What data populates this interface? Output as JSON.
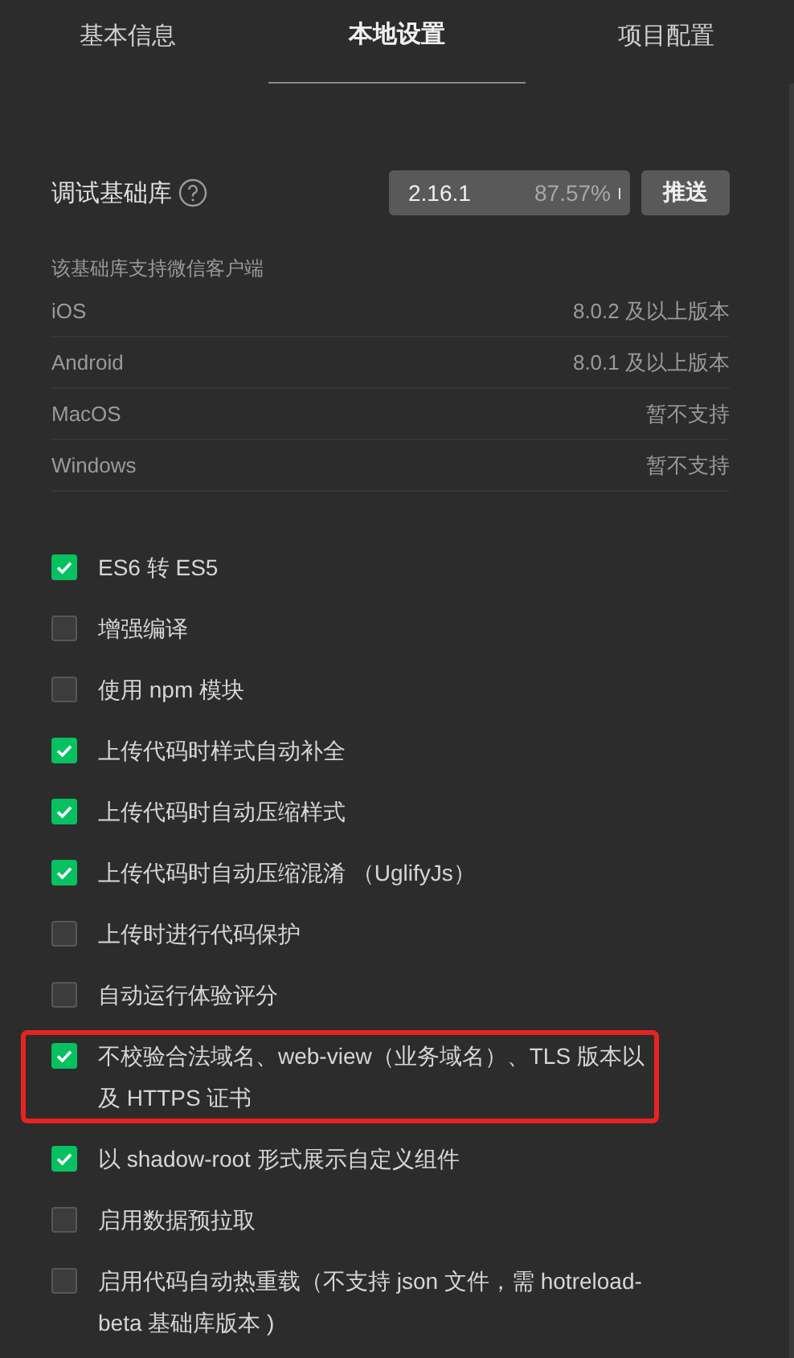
{
  "tabs": [
    {
      "label": "基本信息",
      "selected": false
    },
    {
      "label": "本地设置",
      "selected": true
    },
    {
      "label": "项目配置",
      "selected": false
    }
  ],
  "debug_library": {
    "label": "调试基础库",
    "version": "2.16.1",
    "share": "87.57%",
    "push_button": "推送"
  },
  "support": {
    "title": "该基础库支持微信客户端",
    "rows": [
      {
        "platform": "iOS",
        "requirement": "8.0.2 及以上版本"
      },
      {
        "platform": "Android",
        "requirement": "8.0.1 及以上版本"
      },
      {
        "platform": "MacOS",
        "requirement": "暂不支持"
      },
      {
        "platform": "Windows",
        "requirement": "暂不支持"
      }
    ]
  },
  "options": [
    {
      "label": "ES6 转 ES5",
      "checked": true,
      "highlighted": false
    },
    {
      "label": "增强编译",
      "checked": false,
      "highlighted": false
    },
    {
      "label": "使用 npm 模块",
      "checked": false,
      "highlighted": false
    },
    {
      "label": "上传代码时样式自动补全",
      "checked": true,
      "highlighted": false
    },
    {
      "label": "上传代码时自动压缩样式",
      "checked": true,
      "highlighted": false
    },
    {
      "label": "上传代码时自动压缩混淆 （UglifyJs）",
      "checked": true,
      "highlighted": false
    },
    {
      "label": "上传时进行代码保护",
      "checked": false,
      "highlighted": false
    },
    {
      "label": "自动运行体验评分",
      "checked": false,
      "highlighted": false
    },
    {
      "label": "不校验合法域名、web-view（业务域名）、TLS 版本以及 HTTPS 证书",
      "checked": true,
      "highlighted": true
    },
    {
      "label": "以 shadow-root 形式展示自定义组件",
      "checked": true,
      "highlighted": false
    },
    {
      "label": "启用数据预拉取",
      "checked": false,
      "highlighted": false
    },
    {
      "label": "启用代码自动热重载（不支持 json 文件，需 hotreload-beta 基础库版本 )",
      "checked": false,
      "highlighted": false
    }
  ]
}
